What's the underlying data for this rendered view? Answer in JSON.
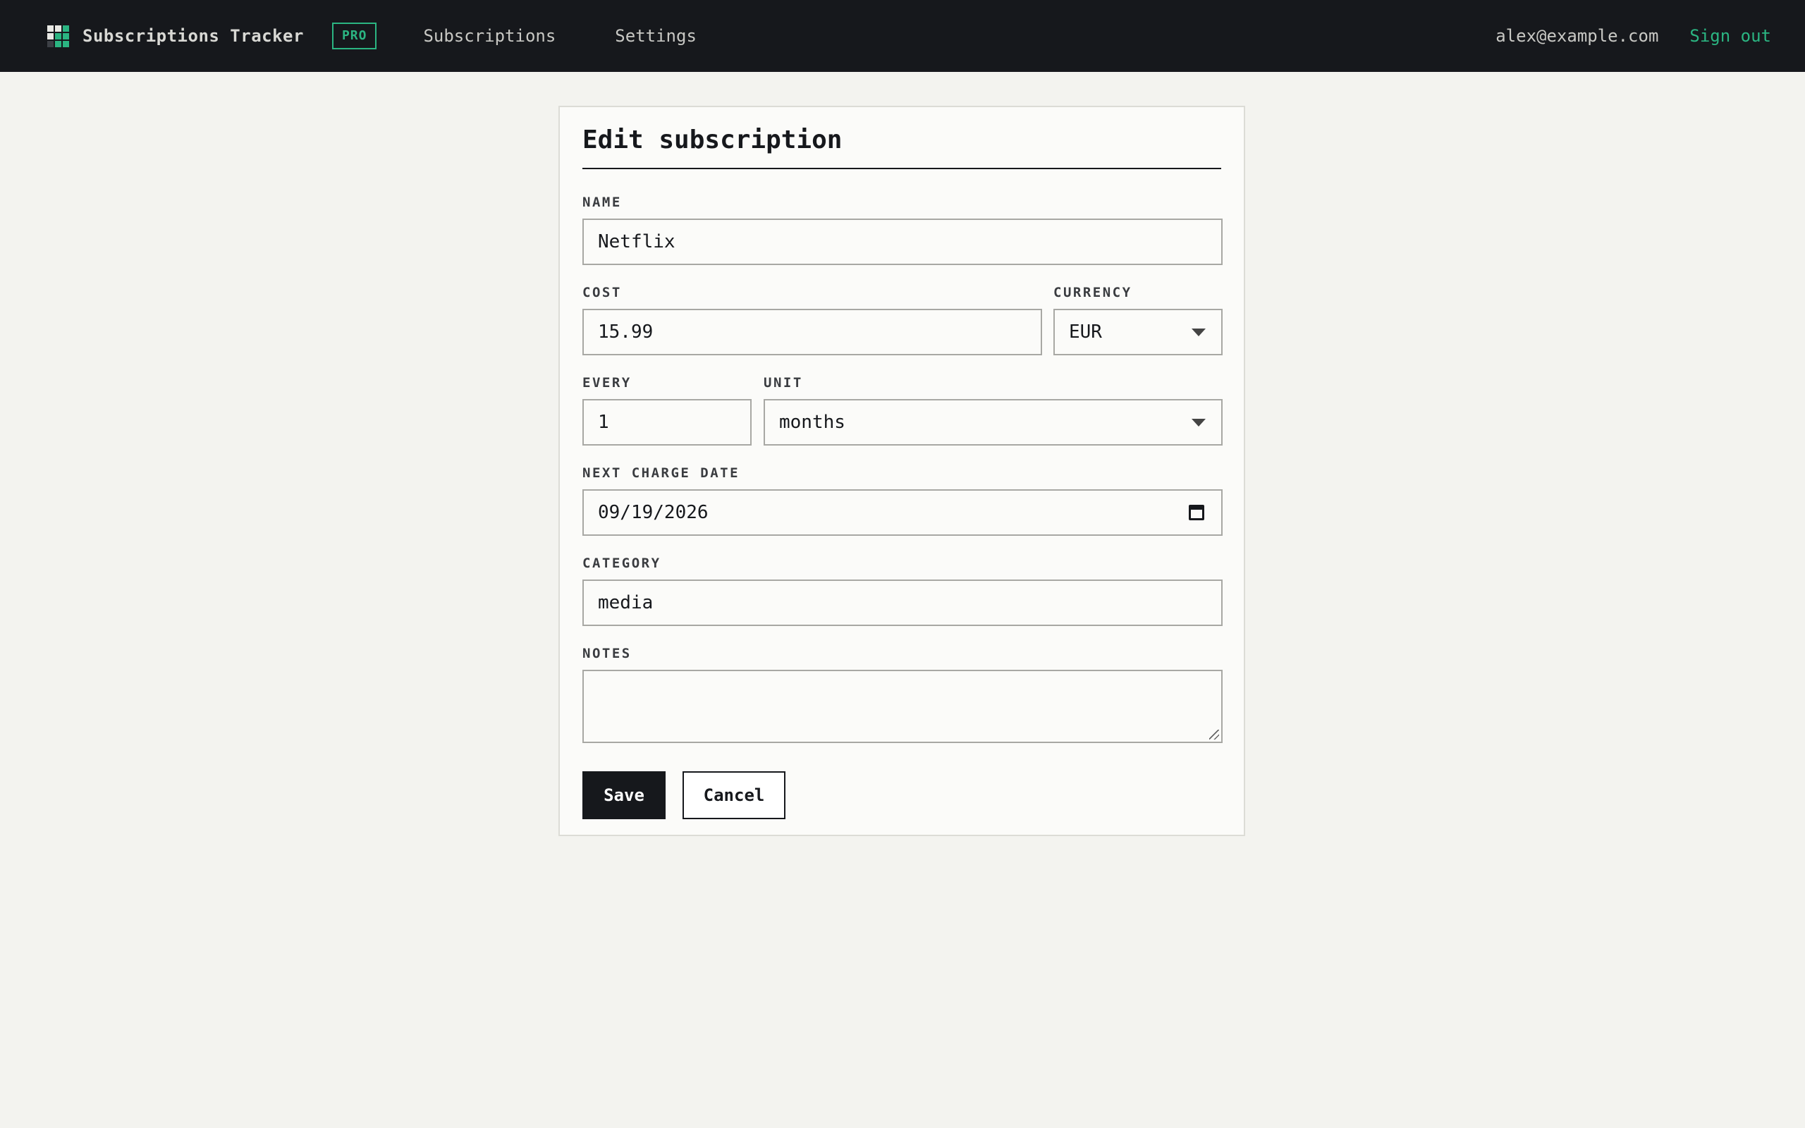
{
  "header": {
    "brand": "Subscriptions Tracker",
    "badge": "PRO",
    "nav": [
      "Subscriptions",
      "Settings"
    ],
    "email": "alex@example.com",
    "sign_out": "Sign out",
    "logo_colors": [
      "#e8e8e4",
      "#e8e8e4",
      "#2bb582",
      "#e8e8e4",
      "#2bb582",
      "#2bb582",
      "#3d4046",
      "#2bb582",
      "#2bb582"
    ]
  },
  "form": {
    "title": "Edit subscription",
    "name": {
      "label": "NAME",
      "value": "Netflix"
    },
    "cost": {
      "label": "COST",
      "value": "15.99"
    },
    "currency": {
      "label": "CURRENCY",
      "value": "EUR"
    },
    "every": {
      "label": "EVERY",
      "value": "1"
    },
    "unit": {
      "label": "UNIT",
      "value": "months"
    },
    "next_charge": {
      "label": "NEXT CHARGE DATE",
      "value": "09/19/2026"
    },
    "category": {
      "label": "CATEGORY",
      "value": "media"
    },
    "notes": {
      "label": "NOTES",
      "value": ""
    },
    "save_label": "Save",
    "cancel_label": "Cancel"
  },
  "colors": {
    "accent": "#2bb582",
    "topbar": "#16181c",
    "background": "#f3f3ef"
  }
}
